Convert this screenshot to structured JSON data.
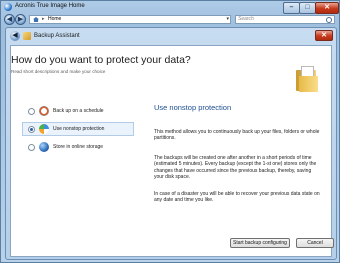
{
  "window": {
    "title": "Acronis True Image Home",
    "minimize": "–",
    "maximize": "□",
    "close": "✕"
  },
  "nav": {
    "back": "◀",
    "forward": "▶",
    "address_text": "Home",
    "address_separator": "▸",
    "address_dropdown": "▾",
    "search_placeholder": "Search"
  },
  "dialog": {
    "back": "◀",
    "title": "Backup Assistant",
    "close": "✕",
    "heading": "How do you want to protect your data?",
    "subheading": "Read short descriptions and make your choice",
    "options": [
      {
        "label": "Back up on a schedule",
        "icon": "clock-icon",
        "selected": false
      },
      {
        "label": "Use nonstop protection",
        "icon": "nonstop-icon",
        "selected": true
      },
      {
        "label": "Store in online storage",
        "icon": "online-storage-icon",
        "selected": false
      }
    ],
    "detail": {
      "title": "Use nonstop protection",
      "paragraphs": [
        "This method allows you to continuously back up your files, folders or whole partitions.",
        "The backups will be created one after another in a short periods of time (estimated 5 minutes). Every backup (except the 1-st one) stores only the changes that have occurred since the previous backup, thereby, saving your disk space.",
        "In case of a disaster you will be able to recover your previous data state on any date and time you like."
      ]
    },
    "buttons": {
      "start": "Start backup configuring",
      "cancel": "Cancel"
    }
  }
}
